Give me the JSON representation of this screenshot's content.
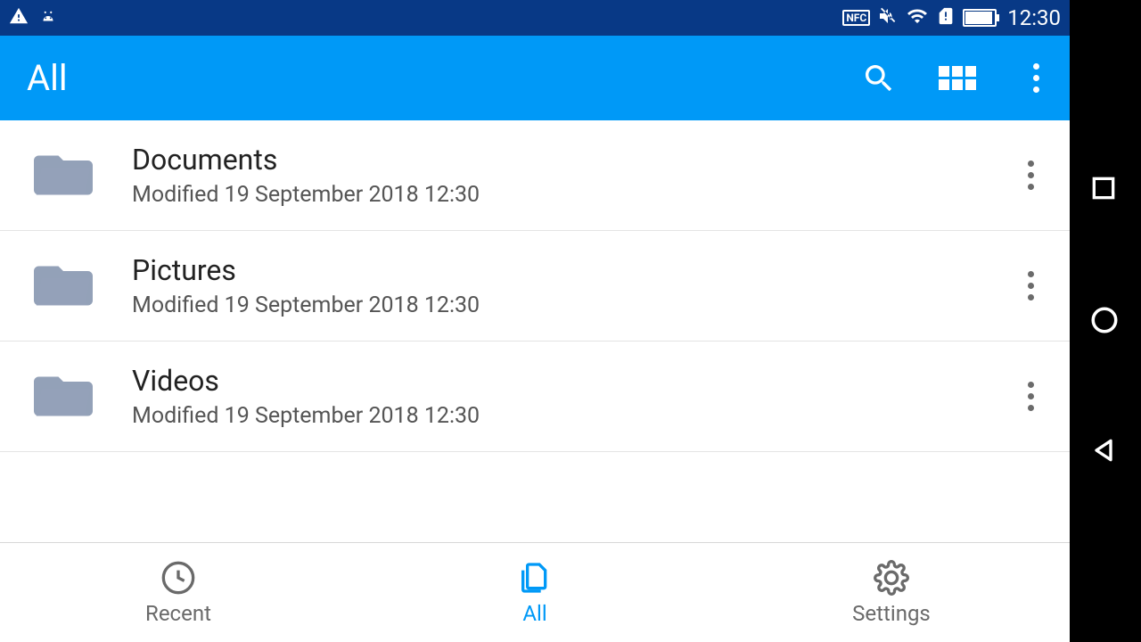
{
  "status": {
    "nfc": "NFC",
    "time": "12:30"
  },
  "appbar": {
    "title": "All"
  },
  "folders": [
    {
      "name": "Documents",
      "subtitle": "Modified 19 September 2018 12:30"
    },
    {
      "name": "Pictures",
      "subtitle": "Modified 19 September 2018 12:30"
    },
    {
      "name": "Videos",
      "subtitle": "Modified 19 September 2018 12:30"
    }
  ],
  "nav": {
    "recent": "Recent",
    "all": "All",
    "settings": "Settings"
  }
}
